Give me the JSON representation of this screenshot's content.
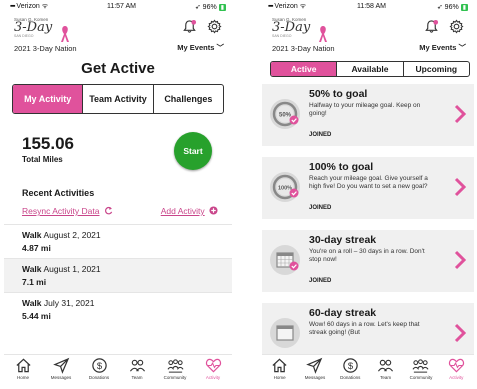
{
  "left": {
    "status": {
      "carrier": "Verizon",
      "time": "11:57 AM",
      "battery": "96%"
    },
    "header": {
      "nation": "2021 3-Day Nation",
      "my_events": "My Events",
      "logo_top": "Susan G. Komen",
      "logo_main": "3-Day",
      "logo_tag": "SAN DIEGO"
    },
    "title": "Get Active",
    "tabs": [
      {
        "label": "My Activity",
        "active": true
      },
      {
        "label": "Team Activity",
        "active": false
      },
      {
        "label": "Challenges",
        "active": false
      }
    ],
    "miles": {
      "value": "155.06",
      "label": "Total Miles"
    },
    "start_label": "Start",
    "recent_title": "Recent Activities",
    "resync_label": "Resync Activity Data",
    "add_label": "Add Activity",
    "activities": [
      {
        "type": "Walk",
        "date": "August 2, 2021",
        "distance": "4.87 mi"
      },
      {
        "type": "Walk",
        "date": "August 1, 2021",
        "distance": "7.1 mi"
      },
      {
        "type": "Walk",
        "date": "July 31, 2021",
        "distance": "5.44 mi"
      }
    ]
  },
  "right": {
    "status": {
      "carrier": "Verizon",
      "time": "11:58 AM",
      "battery": "96%"
    },
    "header": {
      "nation": "2021 3-Day Nation",
      "my_events": "My Events",
      "logo_top": "Susan G. Komen",
      "logo_main": "3-Day",
      "logo_tag": "SAN DIEGO"
    },
    "tabs": [
      {
        "label": "Active",
        "active": true
      },
      {
        "label": "Available",
        "active": false
      },
      {
        "label": "Upcoming",
        "active": false
      }
    ],
    "challenges": [
      {
        "title": "50% to goal",
        "desc": "Halfway to your mileage goal. Keep on going!",
        "status": "JOINED",
        "badge": "50%"
      },
      {
        "title": "100% to goal",
        "desc": "Reach your mileage goal. Give yourself a high five! Do you want to set a new goal?",
        "status": "JOINED",
        "badge": "100%"
      },
      {
        "title": "30-day streak",
        "desc": "You're on a roll – 30 days in a row. Don't stop now!",
        "status": "JOINED",
        "badge": "calendar"
      },
      {
        "title": "60-day streak",
        "desc": "Wow! 60 days in a row. Let's keep that streak going! (But",
        "status": "",
        "badge": "calendar"
      }
    ]
  },
  "tabbar": [
    {
      "label": "Home",
      "icon": "home-icon"
    },
    {
      "label": "Messages",
      "icon": "paper-plane-icon"
    },
    {
      "label": "Donations",
      "icon": "dollar-icon"
    },
    {
      "label": "Team",
      "icon": "team-icon"
    },
    {
      "label": "Community",
      "icon": "community-icon"
    },
    {
      "label": "Activity",
      "icon": "heart-pulse-icon",
      "active": true
    }
  ],
  "colors": {
    "accent": "#e0529c",
    "start": "#27a12c",
    "card": "#f0f0f0"
  }
}
